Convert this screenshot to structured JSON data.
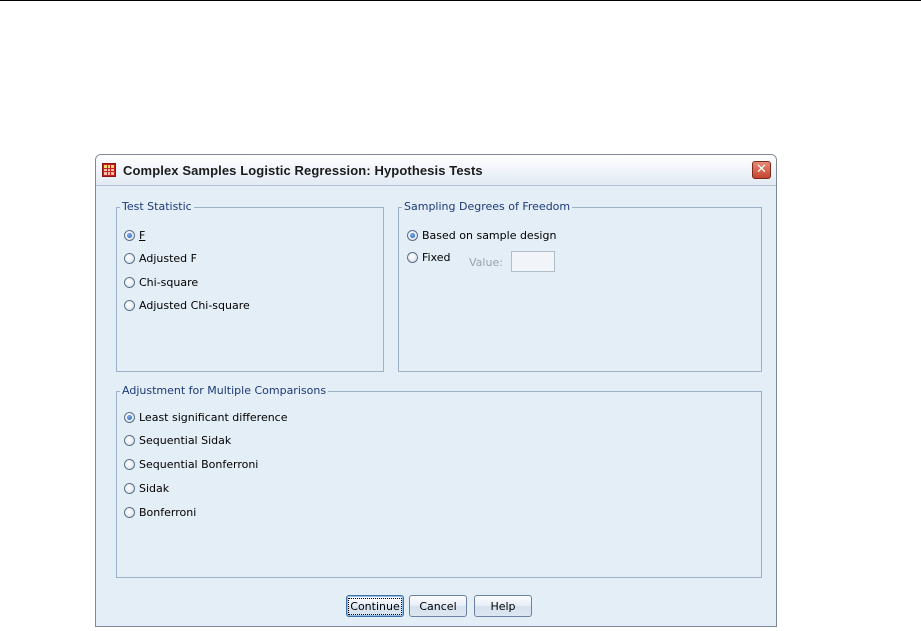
{
  "dialog": {
    "title": "Complex Samples Logistic Regression: Hypothesis Tests",
    "close_glyph": "✕"
  },
  "test_statistic": {
    "title": "Test Statistic",
    "options": [
      {
        "label": "F",
        "checked": true
      },
      {
        "label": "Adjusted F",
        "checked": false
      },
      {
        "label": "Chi-square",
        "checked": false
      },
      {
        "label": "Adjusted Chi-square",
        "checked": false
      }
    ]
  },
  "sampling_df": {
    "title": "Sampling Degrees of Freedom",
    "options": [
      {
        "label": "Based on sample design",
        "checked": true
      },
      {
        "label": "Fixed",
        "checked": false
      }
    ],
    "value_label": "Value:",
    "value": ""
  },
  "multiple_comparisons": {
    "title": "Adjustment for Multiple Comparisons",
    "options": [
      {
        "label": "Least significant difference",
        "checked": true
      },
      {
        "label": "Sequential Sidak",
        "checked": false
      },
      {
        "label": "Sequential Bonferroni",
        "checked": false
      },
      {
        "label": "Sidak",
        "checked": false
      },
      {
        "label": "Bonferroni",
        "checked": false
      }
    ]
  },
  "buttons": {
    "continue": "Continue",
    "cancel": "Cancel",
    "help": "Help"
  },
  "icons": {
    "app": "spss-table-icon",
    "close": "close-icon"
  },
  "colors": {
    "dialog_bg": "#e3eef7",
    "group_title": "#1e3a78",
    "close_button": "#c4452c"
  }
}
